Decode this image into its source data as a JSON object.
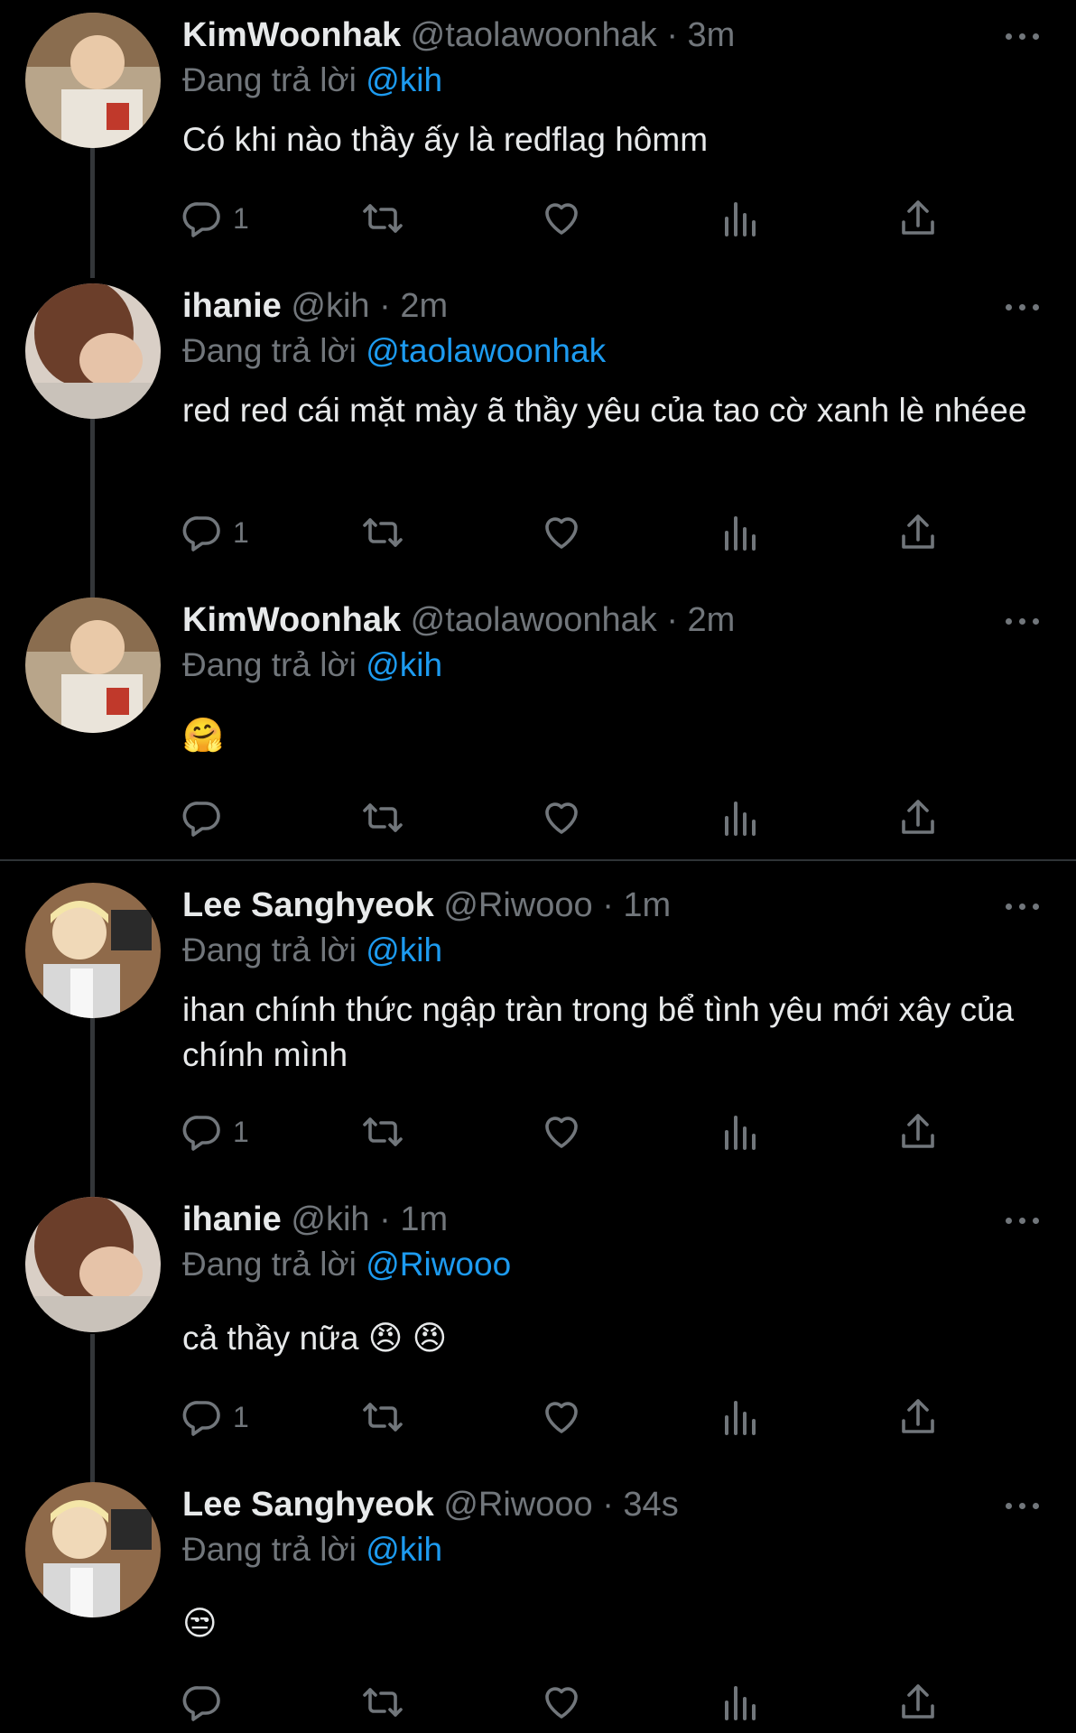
{
  "tweets": [
    {
      "name": "KimWoonhak",
      "handle": "@taolawoonhak",
      "time": "3m",
      "reply_prefix": "Đang trả lời",
      "reply_to": "@kih",
      "text": "Có khi nào thầy ấy là redflag hômm",
      "reply_count": "1"
    },
    {
      "name": "ihanie",
      "handle": "@kih",
      "time": "2m",
      "reply_prefix": "Đang trả lời",
      "reply_to": "@taolawoonhak",
      "text": "red red cái mặt mày ã thầy yêu của tao cờ xanh lè nhéee",
      "reply_count": "1"
    },
    {
      "name": "KimWoonhak",
      "handle": "@taolawoonhak",
      "time": "2m",
      "reply_prefix": "Đang trả lời",
      "reply_to": "@kih",
      "text": "🤗",
      "reply_count": ""
    },
    {
      "name": "Lee Sanghyeok",
      "handle": "@Riwooo",
      "time": "1m",
      "reply_prefix": "Đang trả lời",
      "reply_to": "@kih",
      "text": "ihan chính thức ngập tràn trong bể tình yêu mới xây của chính mình",
      "reply_count": "1"
    },
    {
      "name": "ihanie",
      "handle": "@kih",
      "time": "1m",
      "reply_prefix": "Đang trả lời",
      "reply_to": "@Riwooo",
      "text": "cả thầy nữa 😠 😠",
      "reply_count": "1"
    },
    {
      "name": "Lee Sanghyeok",
      "handle": "@Riwooo",
      "time": "34s",
      "reply_prefix": "Đang trả lời",
      "reply_to": "@kih",
      "text": "😒",
      "reply_count": ""
    }
  ],
  "separator": "·",
  "icons": {
    "reply": "reply-icon",
    "retweet": "retweet-icon",
    "like": "heart-icon",
    "views": "views-icon",
    "share": "share-icon",
    "more": "more-icon"
  },
  "colors": {
    "background": "#000000",
    "text": "#e7e9ea",
    "muted": "#71767b",
    "link": "#1d9bf0",
    "line": "#333639"
  }
}
